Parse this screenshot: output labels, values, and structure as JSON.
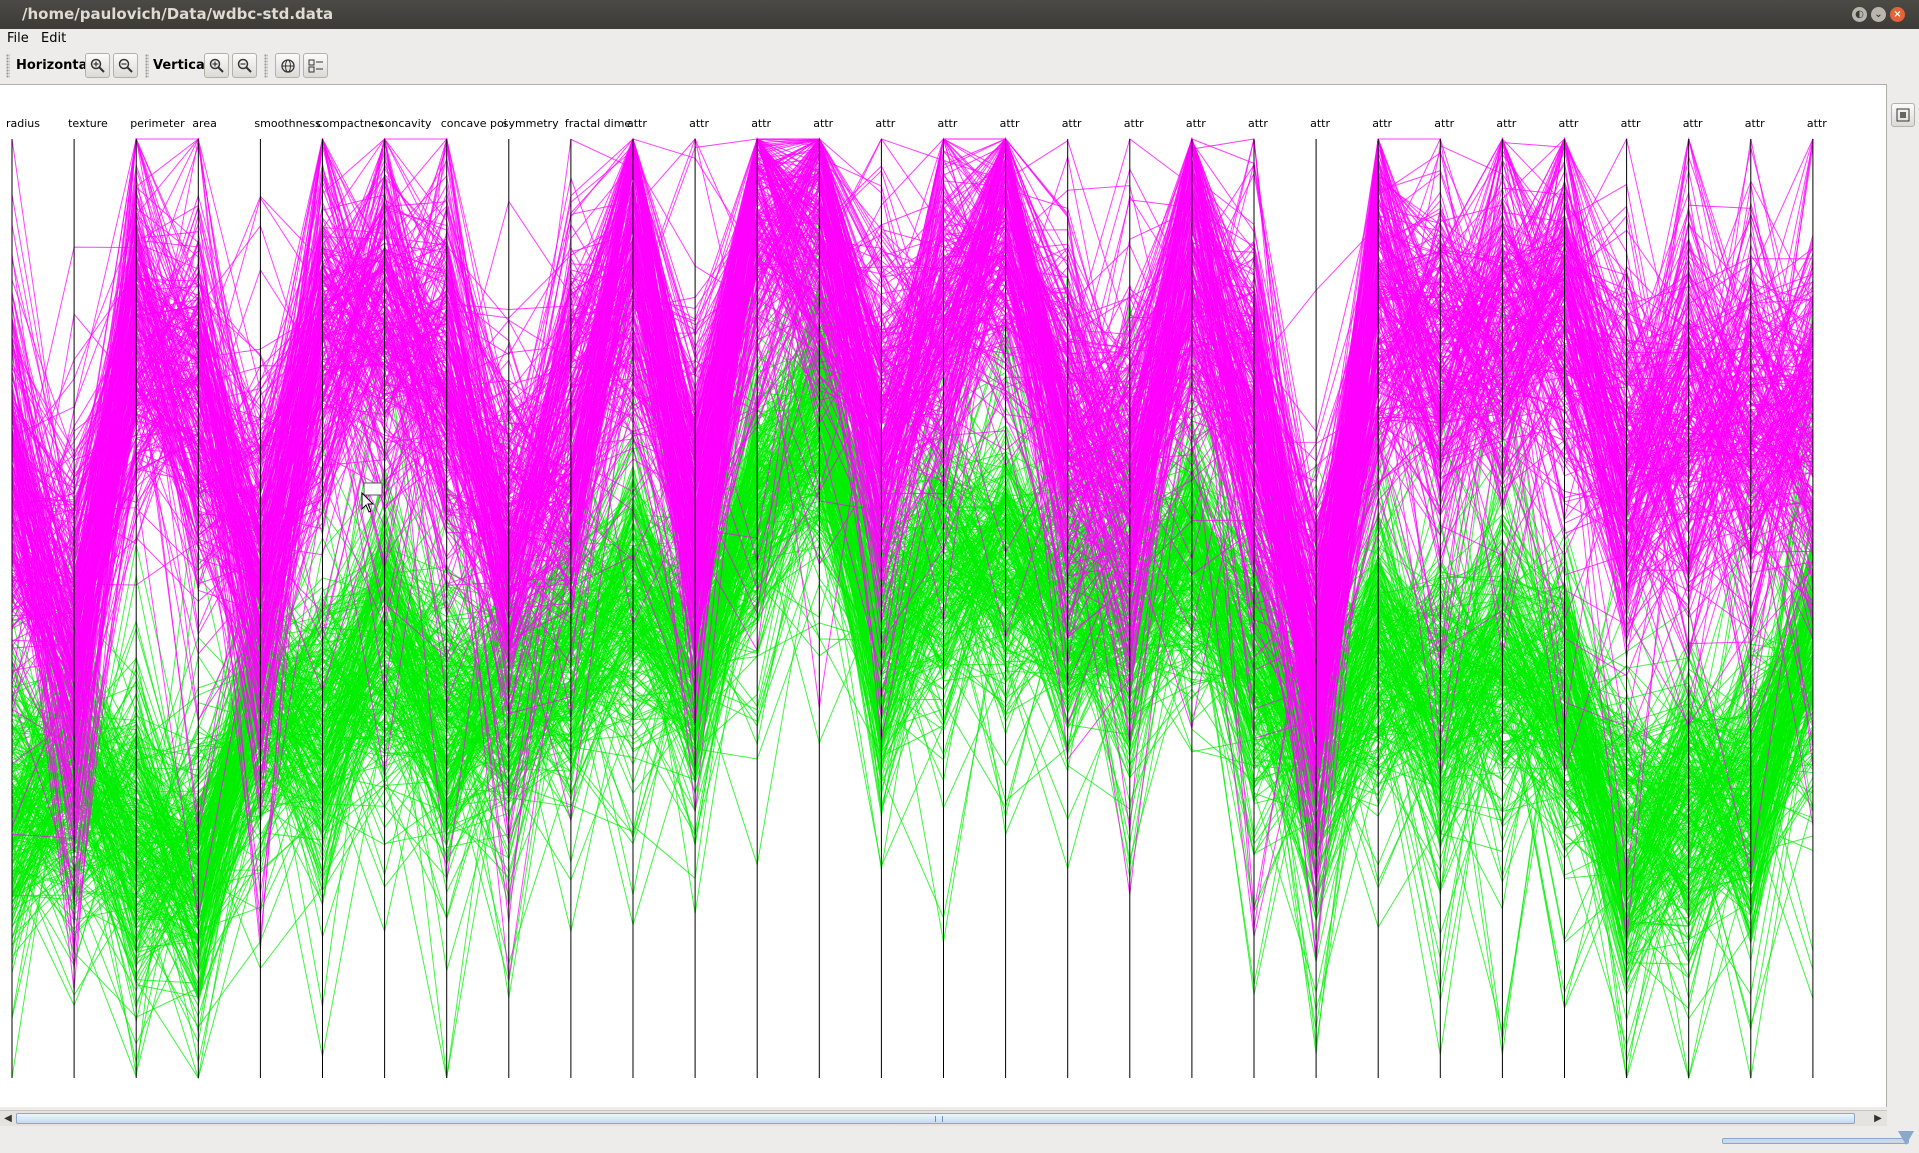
{
  "window": {
    "title": "/home/paulovich/Data/wdbc-std.data"
  },
  "menu": {
    "file": "File",
    "edit": "Edit"
  },
  "toolbar": {
    "horizontal_label": "Horizontal",
    "vertical_label": "Vertical",
    "buttons": [
      "zoom-in-icon",
      "zoom-out-icon",
      "zoom-in-icon",
      "zoom-out-icon",
      "globe-icon",
      "layout-icon"
    ]
  },
  "colors": {
    "class_a": "#ff00ff",
    "class_b": "#00ee00",
    "axis": "#000000"
  },
  "chart_data": {
    "type": "parallel-coordinates",
    "axes": [
      "radius",
      "texture",
      "perimeter",
      "area",
      "smoothness",
      "compactnes",
      "concavity",
      "concave poi",
      "symmetry",
      "fractal dime",
      "attr",
      "attr",
      "attr",
      "attr",
      "attr",
      "attr",
      "attr",
      "attr",
      "attr",
      "attr",
      "attr",
      "attr",
      "attr",
      "attr",
      "attr",
      "attr",
      "attr",
      "attr",
      "attr",
      "attr"
    ],
    "series": [
      {
        "color": "#ff00ff",
        "centers": [
          0.38,
          0.52,
          0.22,
          0.28,
          0.45,
          0.22,
          0.2,
          0.25,
          0.42,
          0.32,
          0.12,
          0.4,
          0.08,
          0.1,
          0.3,
          0.2,
          0.1,
          0.3,
          0.35,
          0.15,
          0.3,
          0.55,
          0.18,
          0.25,
          0.2,
          0.2,
          0.35,
          0.3,
          0.3,
          0.3
        ],
        "spread": 0.28
      },
      {
        "color": "#00ee00",
        "centers": [
          0.72,
          0.68,
          0.75,
          0.78,
          0.6,
          0.62,
          0.55,
          0.62,
          0.6,
          0.55,
          0.5,
          0.55,
          0.4,
          0.3,
          0.52,
          0.45,
          0.45,
          0.5,
          0.5,
          0.45,
          0.55,
          0.65,
          0.55,
          0.6,
          0.55,
          0.6,
          0.75,
          0.72,
          0.7,
          0.55
        ],
        "spread": 0.22
      }
    ],
    "line_count": 260
  }
}
